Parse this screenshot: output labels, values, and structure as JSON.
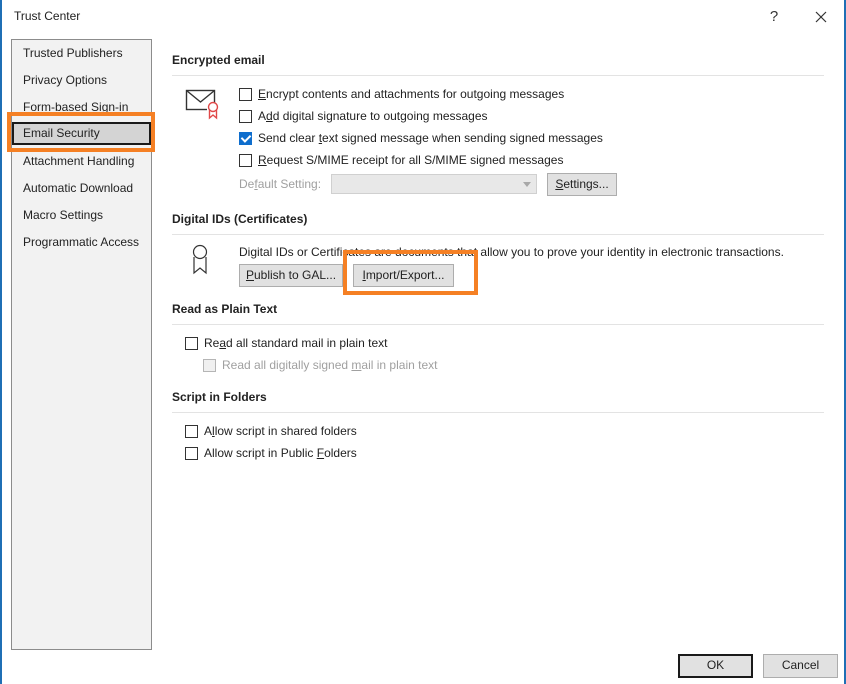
{
  "window": {
    "title": "Trust Center",
    "help_label": "?",
    "close_label": "close"
  },
  "nav": {
    "items": [
      {
        "label": "Trusted Publishers"
      },
      {
        "label": "Privacy Options"
      },
      {
        "label": "Form-based Sign-in"
      },
      {
        "label": "Email Security",
        "selected": true
      },
      {
        "label": "Attachment Handling"
      },
      {
        "label": "Automatic Download"
      },
      {
        "label": "Macro Settings"
      },
      {
        "label": "Programmatic Access"
      }
    ]
  },
  "encrypted_email": {
    "title": "Encrypted email",
    "options": [
      {
        "pre": "",
        "key": "E",
        "post": "ncrypt contents and attachments for outgoing messages",
        "checked": false
      },
      {
        "pre": "A",
        "key": "d",
        "post": "d digital signature to outgoing messages",
        "checked": false
      },
      {
        "pre": "Send clear ",
        "key": "t",
        "post": "ext signed message when sending signed messages",
        "checked": true
      },
      {
        "pre": "",
        "key": "R",
        "post": "equest S/MIME receipt for all S/MIME signed messages",
        "checked": false
      }
    ],
    "default_setting": {
      "pre": "De",
      "key": "f",
      "post": "ault Setting:",
      "value": ""
    },
    "settings_button": {
      "pre": "",
      "key": "S",
      "post": "ettings..."
    }
  },
  "digital_ids": {
    "title": "Digital IDs (Certificates)",
    "description": "Digital IDs or Certificates are documents that allow you to prove your identity in electronic transactions.",
    "publish_button": {
      "pre": "",
      "key": "P",
      "post": "ublish to GAL..."
    },
    "import_export_button": {
      "pre": "",
      "key": "I",
      "post": "mport/Export..."
    }
  },
  "plain_text": {
    "title": "Read as Plain Text",
    "options": [
      {
        "pre": "Re",
        "key": "a",
        "post": "d all standard mail in plain text",
        "checked": false,
        "disabled": false
      },
      {
        "pre": "Read all digitally signed ",
        "key": "m",
        "post": "ail in plain text",
        "checked": false,
        "disabled": true
      }
    ]
  },
  "script_folders": {
    "title": "Script in Folders",
    "options": [
      {
        "pre": "A",
        "key": "l",
        "post": "low script in shared folders",
        "checked": false
      },
      {
        "pre": "Allow script in Public ",
        "key": "F",
        "post": "olders",
        "checked": false
      }
    ]
  },
  "footer": {
    "ok_label": "OK",
    "cancel_label": "Cancel"
  },
  "colors": {
    "accent_checkbox": "#0f6ecd",
    "highlight": "#f58024",
    "window_border": "#1f6fb5",
    "icon_red": "#e04848"
  }
}
